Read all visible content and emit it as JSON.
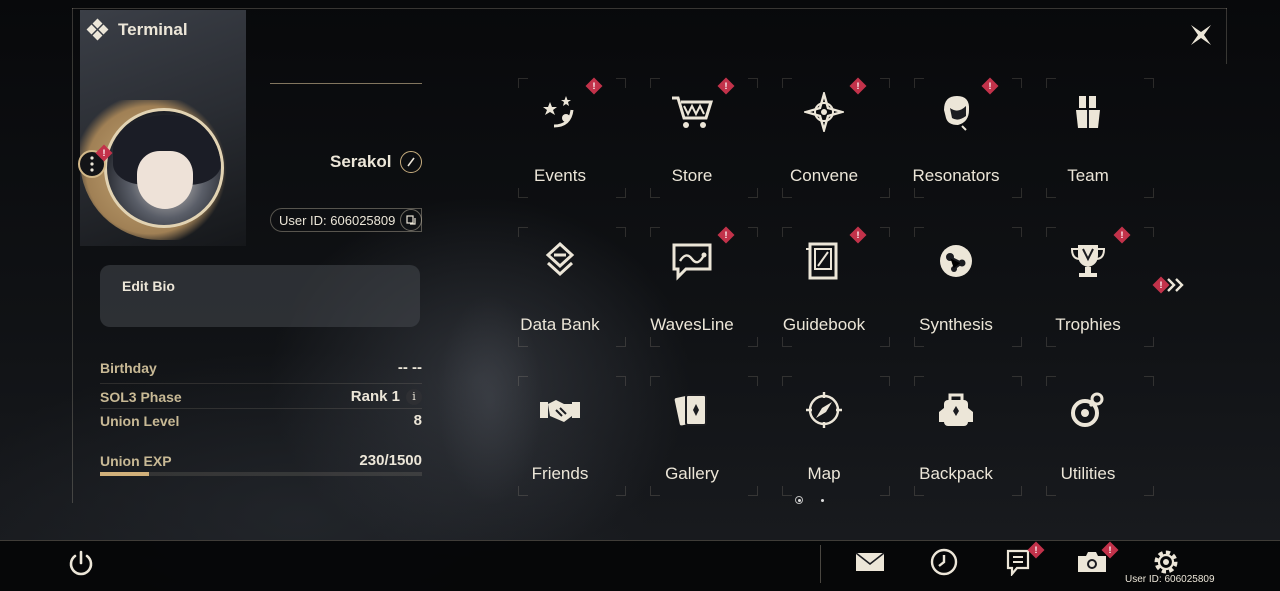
{
  "header": {
    "title": "Terminal"
  },
  "profile": {
    "username": "Serakol",
    "user_id": "User ID: 606025809",
    "bio_label": "Edit Bio",
    "stats": [
      {
        "key": "Birthday",
        "value": "-- --"
      },
      {
        "key": "SOL3 Phase",
        "value": "Rank 1",
        "info": "i"
      },
      {
        "key": "Union Level",
        "value": "8"
      },
      {
        "key": "Union EXP",
        "value": "230/1500"
      }
    ],
    "union_exp_progress": 0.153
  },
  "menu": {
    "items": [
      {
        "label": "Events",
        "icon": "events-icon",
        "badge": true
      },
      {
        "label": "Store",
        "icon": "store-cart-icon",
        "badge": true
      },
      {
        "label": "Convene",
        "icon": "convene-star-icon",
        "badge": true
      },
      {
        "label": "Resonators",
        "icon": "resonator-head-icon",
        "badge": true
      },
      {
        "label": "Team",
        "icon": "team-icon",
        "badge": false
      },
      {
        "label": "Data Bank",
        "icon": "data-bank-icon",
        "badge": false
      },
      {
        "label": "WavesLine",
        "icon": "wavesline-chat-icon",
        "badge": true
      },
      {
        "label": "Guidebook",
        "icon": "guidebook-icon",
        "badge": true
      },
      {
        "label": "Synthesis",
        "icon": "synthesis-icon",
        "badge": false
      },
      {
        "label": "Trophies",
        "icon": "trophy-icon",
        "badge": true
      },
      {
        "label": "Friends",
        "icon": "handshake-icon",
        "badge": false
      },
      {
        "label": "Gallery",
        "icon": "gallery-cards-icon",
        "badge": false
      },
      {
        "label": "Map",
        "icon": "compass-icon",
        "badge": false
      },
      {
        "label": "Backpack",
        "icon": "backpack-icon",
        "badge": false
      },
      {
        "label": "Utilities",
        "icon": "utilities-icon",
        "badge": false
      }
    ],
    "badge_glyph": "!",
    "current_page": 1,
    "page_count": 2
  },
  "bottom_bar": {
    "user_id": "User ID: 606025809",
    "icons": [
      "mail-icon",
      "clock-icon",
      "notice-icon",
      "camera-icon",
      "settings-gear-icon"
    ]
  },
  "colors": {
    "accent_gold": "#d1b07a",
    "badge_red": "#c2324a",
    "text": "#ece6d8"
  }
}
